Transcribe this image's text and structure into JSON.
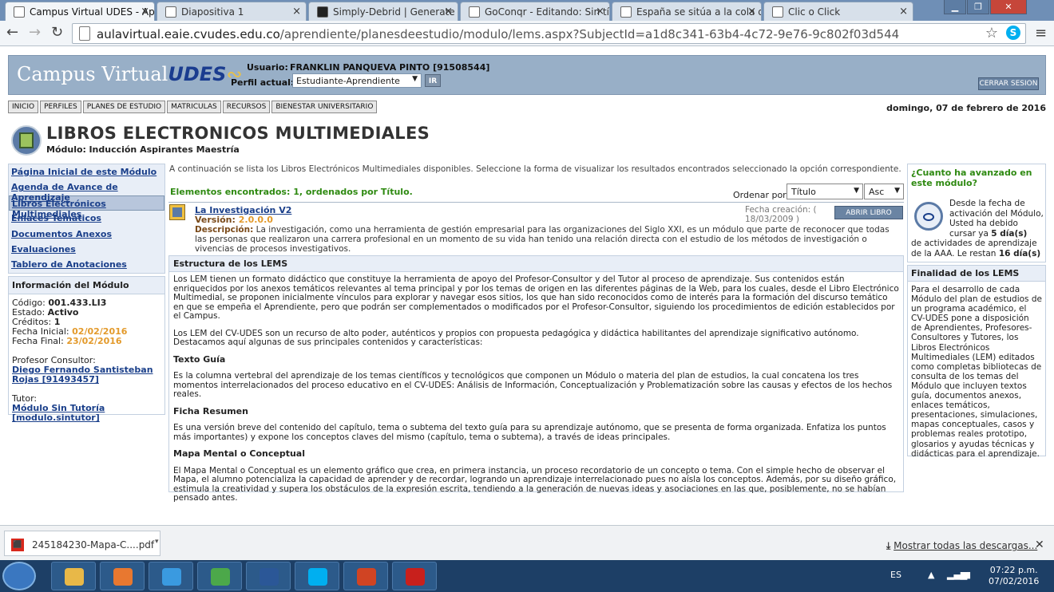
{
  "browser": {
    "tabs": [
      {
        "label": "Campus Virtual UDES - Ap",
        "active": true,
        "icon": "page-icon",
        "color": "#ffffff"
      },
      {
        "label": "Diapositiva 1",
        "active": false,
        "icon": "page-icon",
        "color": "#ffffff"
      },
      {
        "label": "Simply-Debrid | Generate",
        "active": false,
        "icon": "sd-icon",
        "color": "#222222"
      },
      {
        "label": "GoConqr - Editando: Sin tí",
        "active": false,
        "icon": "goconqr-icon",
        "color": "#ffffff"
      },
      {
        "label": "España se sitúa a la cola d",
        "active": false,
        "icon": "mf-icon",
        "color": "#ffffff"
      },
      {
        "label": "Clic o Click",
        "active": false,
        "icon": "page-icon",
        "color": "#ffffff"
      }
    ],
    "url_domain": "aulavirtual.eaie.cvudes.edu.co",
    "url_path": "/aprendiente/planesdeestudio/modulo/lems.aspx?SubjectId=a1d8c341-63b4-4c72-9e76-9c802f03d544"
  },
  "header": {
    "logo_text": "Campus Virtual",
    "logo_brand": "UDES",
    "user_label": "Usuario:",
    "user_name": "FRANKLIN PANQUEVA PINTO [91508544]",
    "profile_label": "Perfil actual:",
    "profile_value": "Estudiante-Aprendiente",
    "go_label": "IR",
    "logout_label": "CERRAR SESION"
  },
  "menu": [
    "INICIO",
    "PERFILES",
    "PLANES DE ESTUDIO",
    "MATRICULAS",
    "RECURSOS",
    "BIENESTAR UNIVERSITARIO"
  ],
  "date": "domingo, 07 de febrero de 2016",
  "page": {
    "title": "LIBROS ELECTRONICOS MULTIMEDIALES",
    "module_label": "Módulo:",
    "module_name": "Inducción Aspirantes Maestría"
  },
  "sidebar": {
    "items": [
      {
        "label": "Página Inicial de este Módulo",
        "selected": false
      },
      {
        "label": "Agenda de Avance de Aprendizaje",
        "selected": false
      },
      {
        "label": "Libros Electrónicos Multimediales",
        "selected": true
      },
      {
        "label": "Enlaces Temáticos",
        "selected": false
      },
      {
        "label": "Documentos Anexos",
        "selected": false
      },
      {
        "label": "Evaluaciones",
        "selected": false
      },
      {
        "label": "Tablero de Anotaciones",
        "selected": false
      }
    ]
  },
  "info": {
    "title": "Información del Módulo",
    "code_label": "Código:",
    "code": "001.433.LI3",
    "state_label": "Estado:",
    "state": "Activo",
    "credits_label": "Créditos:",
    "credits": "1",
    "start_label": "Fecha Inicial:",
    "start": "02/02/2016",
    "end_label": "Fecha Final:",
    "end": "23/02/2016",
    "consultant_label": "Profesor Consultor:",
    "consultant": "Diego Fernando Santisteban Rojas [91493457]",
    "tutor_label": "Tutor:",
    "tutor": "Módulo Sin Tutoría [modulo.sintutor]"
  },
  "results": {
    "intro": "A continuación se lista los Libros Electrónicos Multimediales disponibles. Seleccione la forma de visualizar los resultados encontrados seleccionado la opción correspondiente.",
    "found": "Elementos encontrados: 1, ordenados por Título.",
    "order_label": "Ordenar por:",
    "order_field": "Título",
    "order_dir": "Asc",
    "book": {
      "title": "La Investigación V2",
      "version_label": "Versión:",
      "version": "2.0.0.0",
      "desc_label": "Descripción:",
      "desc": "La investigación, como una herramienta de gestión empresarial para las organizaciones del Siglo XXI, es un módulo que parte de reconocer que todas las personas que realizaron una carrera profesional en un momento de su vida han tenido una relación directa con el estudio de los métodos de investigación o vivencias de procesos investigativos.",
      "created_label": "Fecha creación: (",
      "created": "18/03/2009 )",
      "open_label": "ABRIR LIBRO"
    }
  },
  "structure": {
    "title": "Estructura de los LEMS",
    "p1": "Los LEM tienen un formato didáctico que constituye la herramienta de apoyo del Profesor-Consultor y del Tutor al proceso de aprendizaje. Sus contenidos están enriquecidos por los anexos temáticos relevantes al tema principal y por los temas de origen en las diferentes páginas de la Web, para los cuales, desde el Libro Electrónico Multimedial, se proponen inicialmente vínculos para explorar y navegar esos sitios, los que han sido reconocidos como de interés para la formación del discurso temático en que se empeña el Aprendiente, pero que podrán ser complementados o modificados por el Profesor-Consultor, siguiendo los procedimientos de edición establecidos por el Campus.",
    "p2": "Los LEM del CV-UDES son un recurso de alto poder, auténticos y propios con propuesta pedagógica y didáctica habilitantes del aprendizaje significativo autónomo. Destacamos aquí algunas de sus principales contenidos y características:",
    "h1": "Texto Guía",
    "p3": "Es la columna vertebral del aprendizaje de los temas científicos y tecnológicos que componen un Módulo o materia del plan de estudios, la cual concatena los tres momentos interrelacionados del proceso educativo en el CV-UDES: Análisis de Información, Conceptualización y Problematización sobre las causas y efectos de los hechos reales.",
    "h2": "Ficha Resumen",
    "p4": "Es una versión breve del contenido del capítulo, tema o subtema del texto guía para su aprendizaje autónomo, que se presenta de forma organizada. Enfatiza los puntos más importantes) y expone los conceptos claves del mismo (capítulo, tema o subtema), a través de ideas principales.",
    "h3": "Mapa Mental o Conceptual",
    "p5": "El Mapa Mental o Conceptual es un elemento gráfico que crea, en primera instancia, un proceso recordatorio de un concepto o tema. Con el simple hecho de observar el Mapa, el alumno potencializa la capacidad de aprender y de recordar, logrando un aprendizaje interrelacionado pues no aísla los conceptos. Además, por su diseño gráfico, estimula la creatividad y supera los obstáculos de la expresión escrita, tendiendo a la generación de nuevas ideas y asociaciones en las que, posiblemente, no se habían pensado antes."
  },
  "progress": {
    "question": "¿Cuanto ha avanzado en este módulo?",
    "text_a": "Desde la fecha de activación del Módulo, Usted ha debido cursar ya",
    "days_done": "5 día(s)",
    "text_b": "de actividades de aprendizaje de la AAA. Le restan",
    "days_left": "16 día(s)"
  },
  "purpose": {
    "title": "Finalidad de los LEMS",
    "text": "Para el desarrollo de cada Módulo del plan de estudios de un programa académico, el CV-UDES pone a disposición de Aprendientes, Profesores-Consultores y Tutores, los Libros Electrónicos Multimediales (LEM) editados como completas bibliotecas de consulta de los temas del Módulo que incluyen textos guía, documentos anexos, enlaces temáticos, presentaciones, simulaciones, mapas conceptuales, casos y problemas reales prototipo, glosarios y ayudas técnicas y didácticas para el aprendizaje."
  },
  "downloads": {
    "file": "245184230-Mapa-C....pdf",
    "show_all": "Mostrar todas las descargas..."
  },
  "taskbar": {
    "apps": [
      {
        "name": "explorer-icon",
        "color": "#e8b848"
      },
      {
        "name": "media-player-icon",
        "color": "#e87830"
      },
      {
        "name": "ie-icon",
        "color": "#3a9ae0"
      },
      {
        "name": "chrome-icon",
        "color": "#4ca84a"
      },
      {
        "name": "word-icon",
        "color": "#2b5797"
      },
      {
        "name": "skype-icon",
        "color": "#00aff0"
      },
      {
        "name": "powerpoint-icon",
        "color": "#d04423"
      },
      {
        "name": "acrobat-icon",
        "color": "#c8201c"
      }
    ],
    "lang": "ES",
    "time": "07:22 p.m.",
    "date": "07/02/2016"
  }
}
